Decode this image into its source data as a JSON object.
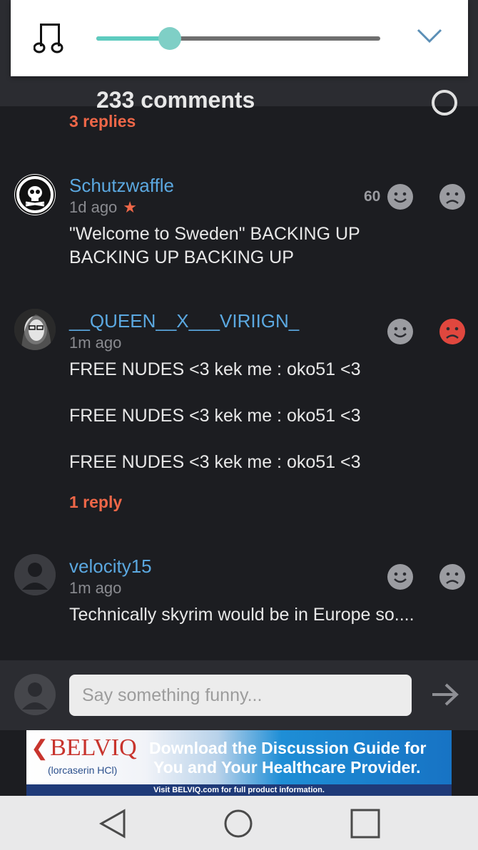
{
  "header": {
    "title_partial": "233 comments"
  },
  "volume_panel": {
    "level_percent": 26
  },
  "comments": [
    {
      "replies_link": "3 replies"
    },
    {
      "username": "Schutzwaffle",
      "time": "1d ago",
      "starred": true,
      "vote_count": "60",
      "lines": [
        "\"Welcome to Sweden\" BACKING UP",
        "BACKING UP BACKING UP"
      ]
    },
    {
      "username": "__QUEEN__X___VIRIIGN_",
      "time": "1m ago",
      "lines": [
        "FREE NUDES <3 kek me : oko51 <3",
        "FREE NUDES <3 kek me : oko51 <3",
        "FREE NUDES <3 kek me : oko51 <3"
      ],
      "replies_link": "1 reply",
      "downvoted": true
    },
    {
      "username": "velocity15",
      "time": "1m ago",
      "lines": [
        "Technically skyrim would be in Europe so...."
      ]
    }
  ],
  "composer": {
    "placeholder": "Say something funny..."
  },
  "ad": {
    "brand": "BELVIQ",
    "generic": "(lorcaserin HCl)",
    "headline_line1": "Download the Discussion Guide for",
    "headline_line2": "You and Your Healthcare Provider.",
    "footer": "Visit BELVIQ.com for full product information."
  },
  "colors": {
    "accent": "#ef6748",
    "username": "#5ba8e0",
    "slider": "#5ecbbf",
    "background": "#1c1d21",
    "downvote_active": "#e0473e"
  }
}
